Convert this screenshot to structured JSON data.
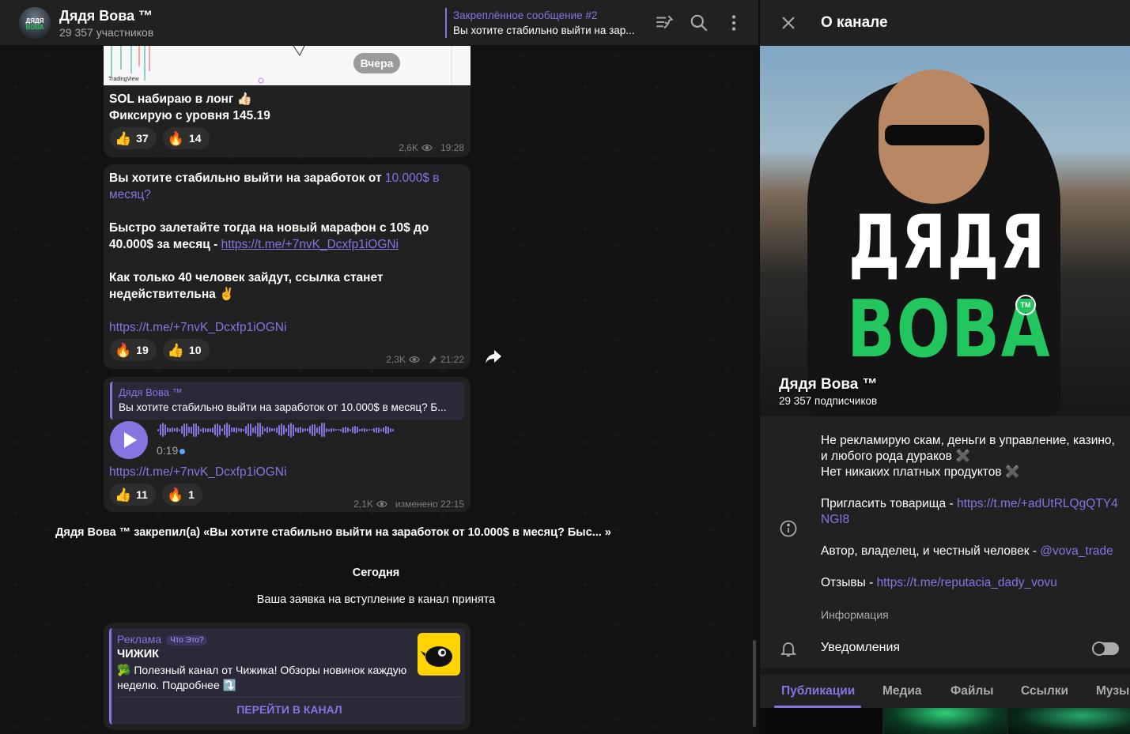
{
  "header": {
    "avatar_top": "ДЯДЯ",
    "avatar_bottom": "ВОВА",
    "title": "Дядя Вова ™",
    "subtitle": "29 357 участников",
    "pinned_title": "Закреплённое сообщение #2",
    "pinned_text": "Вы хотите стабильно выйти на зар..."
  },
  "date_yesterday": "Вчера",
  "messages": [
    {
      "line1": "SOL набираю в лонг 👍🏻",
      "line2": "Фиксирую с уровня 145.19",
      "reactions": [
        {
          "emoji": "👍",
          "count": "37"
        },
        {
          "emoji": "🔥",
          "count": "14"
        }
      ],
      "views": "2,6K",
      "time": "19:28"
    },
    {
      "p1": "Вы хотите стабильно выйти на заработок от ",
      "p1_link": "10.000$ в месяц?",
      "p2": "Быстро залетайте тогда на новый марафон с 10$ до 40.000$ за месяц - ",
      "p2_link": "https://t.me/+7nvK_Dcxfp1iOGNi",
      "p3": "Как только 40 человек зайдут, ссылка станет недействительна ✌️",
      "p4_link": "https://t.me/+7nvK_Dcxfp1iOGNi",
      "reactions": [
        {
          "emoji": "🔥",
          "count": "19"
        },
        {
          "emoji": "👍",
          "count": "10"
        }
      ],
      "views": "2,3K",
      "time": "21:22"
    },
    {
      "quote_name": "Дядя Вова ™",
      "quote_text": "Вы хотите стабильно выйти на заработок от 10.000$ в месяц? Б...",
      "duration": "0:19",
      "link": "https://t.me/+7nvK_Dcxfp1iOGNi",
      "reactions": [
        {
          "emoji": "👍",
          "count": "11"
        },
        {
          "emoji": "🔥",
          "count": "1"
        }
      ],
      "views": "2,1K",
      "time": "изменено 22:15"
    }
  ],
  "system": {
    "pinned_notice": "Дядя Вова ™ закрепил(а) «Вы хотите стабильно выйти на заработок от 10.000$ в месяц? Быс... »",
    "today": "Сегодня",
    "joined": "Ваша заявка на вступление в канал принята"
  },
  "ad": {
    "label": "Реклама",
    "what": "Что Это?",
    "name": "ЧИЖИК",
    "text": "🥦 Полезный канал от Чижика! Обзоры новинок каждую неделю. Подробнее ⤵️",
    "button": "ПЕРЕЙТИ В КАНАЛ"
  },
  "sidebar": {
    "title": "О канале",
    "cover_big1": "ДЯДЯ",
    "cover_big2": "ВОВА",
    "cover_tm": "TM",
    "name": "Дядя Вова ™",
    "subscribers": "29 357 подписчиков",
    "desc_l1": "Не рекламирую скам, деньги в управление, казино, и любого рода дураков ✖️",
    "desc_l2": "Нет никаких платных продуктов ✖️",
    "invite_prefix": "Пригласить товарища - ",
    "invite_link": "https://t.me/+adUtRLQgQTY4NGI8",
    "author_prefix": "Автор, владелец, и честный человек - ",
    "author_link": "@vova_trade",
    "reviews_prefix": "Отзывы - ",
    "reviews_link": "https://t.me/reputacia_dady_vovu",
    "info_label": "Информация",
    "notifications": "Уведомления",
    "tabs": [
      "Публикации",
      "Медиа",
      "Файлы",
      "Ссылки",
      "Музы"
    ]
  },
  "colors": {
    "accent": "#8774e1",
    "bubble": "#212121",
    "brand_green": "#22c55e"
  }
}
